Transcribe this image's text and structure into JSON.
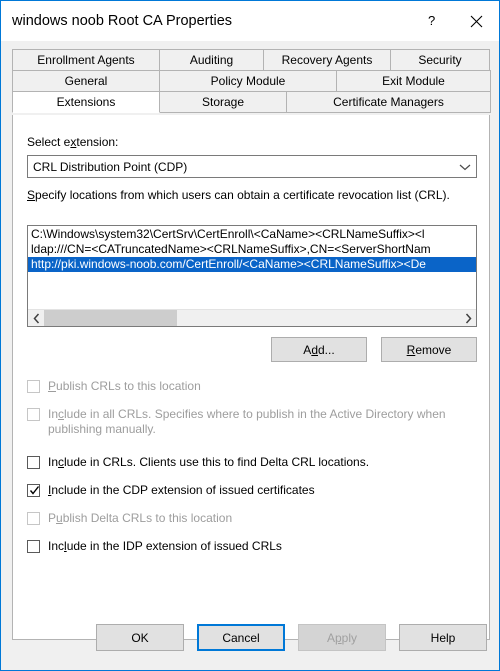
{
  "window": {
    "title": "windows noob Root CA Properties",
    "help_icon": "question-mark-icon",
    "close_icon": "close-icon",
    "border_color": "#0078d7"
  },
  "tabs": {
    "rows": [
      [
        {
          "label": "Enrollment Agents",
          "active": false
        },
        {
          "label": "Auditing",
          "active": false
        },
        {
          "label": "Recovery Agents",
          "active": false
        },
        {
          "label": "Security",
          "active": false
        }
      ],
      [
        {
          "label": "General",
          "active": false
        },
        {
          "label": "Policy Module",
          "active": false
        },
        {
          "label": "Exit Module",
          "active": false
        }
      ],
      [
        {
          "label": "Extensions",
          "active": true
        },
        {
          "label": "Storage",
          "active": false
        },
        {
          "label": "Certificate Managers",
          "active": false
        }
      ]
    ]
  },
  "extensions_page": {
    "select_extension_label_pre": "Select e",
    "select_extension_label_acc": "x",
    "select_extension_label_post": "tension:",
    "selected_extension": "CRL Distribution Point (CDP)",
    "dropdown_icon": "chevron-down-icon",
    "description_acc": "S",
    "description_rest": "pecify locations from which users can obtain a certificate revocation list (CRL).",
    "locations": [
      {
        "text": "C:\\Windows\\system32\\CertSrv\\CertEnroll\\<CaName><CRLNameSuffix><l",
        "selected": false
      },
      {
        "text": "ldap:///CN=<CATruncatedName><CRLNameSuffix>,CN=<ServerShortNam",
        "selected": false
      },
      {
        "text": "http://pki.windows-noob.com/CertEnroll/<CaName><CRLNameSuffix><De",
        "selected": true
      }
    ],
    "selection_color": "#0a64c8",
    "scrollbar": {
      "left_arrow_icon": "chevron-left-icon",
      "right_arrow_icon": "chevron-right-icon"
    },
    "add_button": {
      "pre": "A",
      "acc": "d",
      "post": "d..."
    },
    "remove_button": {
      "pre": "",
      "acc": "R",
      "post": "emove"
    },
    "checkboxes": [
      {
        "pre": "",
        "acc": "P",
        "post": "ublish CRLs to this location",
        "checked": false,
        "enabled": false
      },
      {
        "pre": "In",
        "acc": "c",
        "post": "lude in all CRLs. Specifies where to publish in the Active Directory when publishing manually.",
        "checked": false,
        "enabled": false
      },
      {
        "pre": "In",
        "acc": "c",
        "post": "lude in CRLs. Clients use this to find Delta CRL locations.",
        "checked": false,
        "enabled": true
      },
      {
        "pre": "",
        "acc": "I",
        "post": "nclude in the CDP extension of issued certificates",
        "checked": true,
        "enabled": true
      },
      {
        "pre": "P",
        "acc": "u",
        "post": "blish Delta CRLs to this location",
        "checked": false,
        "enabled": false
      },
      {
        "pre": "Inc",
        "acc": "l",
        "post": "ude in the IDP extension of issued CRLs",
        "checked": false,
        "enabled": true
      }
    ]
  },
  "footer": {
    "ok": "OK",
    "cancel": "Cancel",
    "apply_pre": "A",
    "apply_acc": "p",
    "apply_post": "ply",
    "help": "Help"
  }
}
